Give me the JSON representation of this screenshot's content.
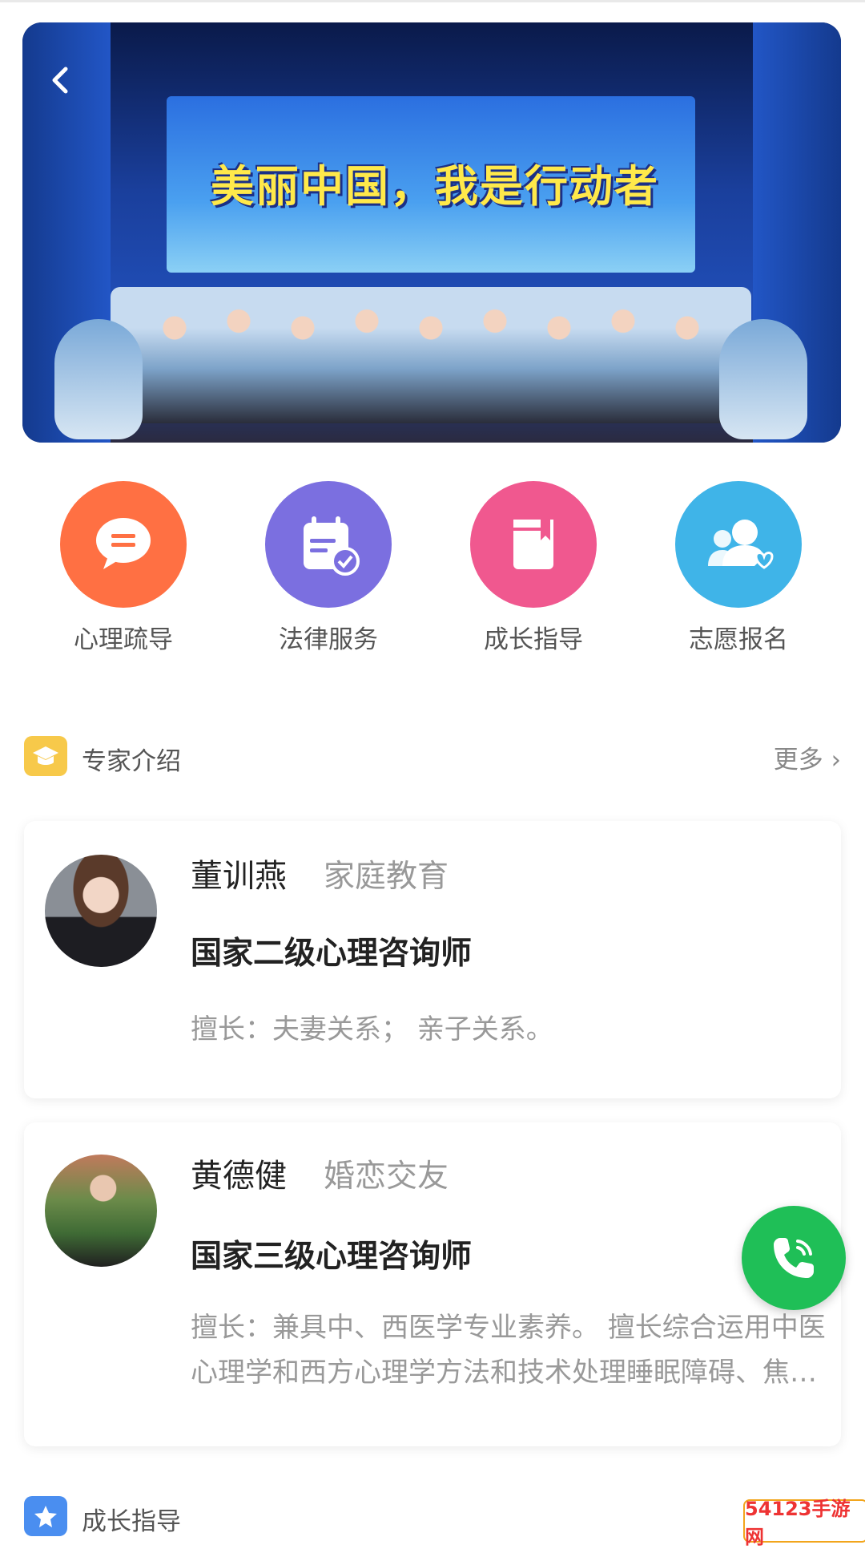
{
  "banner": {
    "headline": "美丽中国，我是行动者",
    "back_icon": "chevron-left-icon"
  },
  "entries": [
    {
      "label": "心理疏导",
      "icon": "chat-bubble-icon",
      "color": "#ff7043"
    },
    {
      "label": "法律服务",
      "icon": "calendar-check-icon",
      "color": "#7b6fe0"
    },
    {
      "label": "成长指导",
      "icon": "book-icon",
      "color": "#f0588f"
    },
    {
      "label": "志愿报名",
      "icon": "users-heart-icon",
      "color": "#3fb4e8"
    }
  ],
  "experts_section": {
    "title": "专家介绍",
    "more": "更多 ›",
    "badge_color": "#f7c94a"
  },
  "experts": [
    {
      "name": "董训燕",
      "category": "家庭教育",
      "title": "国家二级心理咨询师",
      "desc": "擅长：夫妻关系； 亲子关系。"
    },
    {
      "name": "黄德健",
      "category": "婚恋交友",
      "title": "国家三级心理咨询师",
      "desc": "擅长：兼具中、西医学专业素养。 擅长综合运用中医心理学和西方心理学方法和技术处理睡眠障碍、焦虑抑郁等问题"
    }
  ],
  "growth_section": {
    "title": "成长指导",
    "badge_color": "#4a8ef0"
  },
  "call_button": {
    "icon": "phone-icon",
    "color": "#1fbf57"
  },
  "watermark": {
    "text": "54123手游网"
  }
}
